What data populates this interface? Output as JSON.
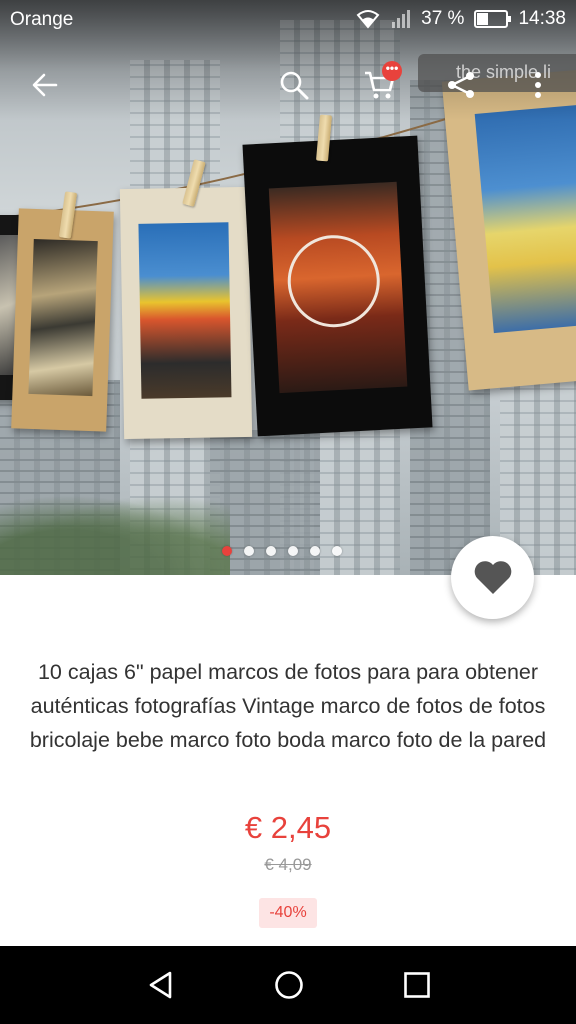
{
  "status_bar": {
    "carrier": "Orange",
    "battery_percent": "37 %",
    "battery_level": 0.37,
    "time": "14:38",
    "icons": [
      "wifi-icon",
      "signal-icon",
      "battery-icon"
    ]
  },
  "toolbar": {
    "back_icon": "arrow-left-icon",
    "search_icon": "search-icon",
    "cart_icon": "cart-icon",
    "cart_badge": "•••",
    "store_chip": "the simple li",
    "share_icon": "share-icon",
    "more_icon": "more-vertical-icon"
  },
  "gallery": {
    "image_count": 6,
    "active_index": 0
  },
  "favorite": {
    "icon": "heart-icon"
  },
  "product": {
    "title": "10 cajas 6\" papel marcos de fotos para para obtener auténticas fotografías Vintage marco de fotos de fotos bricolaje bebe marco foto boda marco foto de la pared",
    "price": "€ 2,45",
    "original_price": "€ 4,09",
    "discount": "-40%"
  },
  "colors": {
    "accent": "#e8423c",
    "text": "#333333",
    "muted": "#999999",
    "discount_bg": "#fde4e4"
  },
  "navigation_bar": {
    "icons": [
      "back-triangle-icon",
      "home-circle-icon",
      "recents-square-icon"
    ]
  }
}
